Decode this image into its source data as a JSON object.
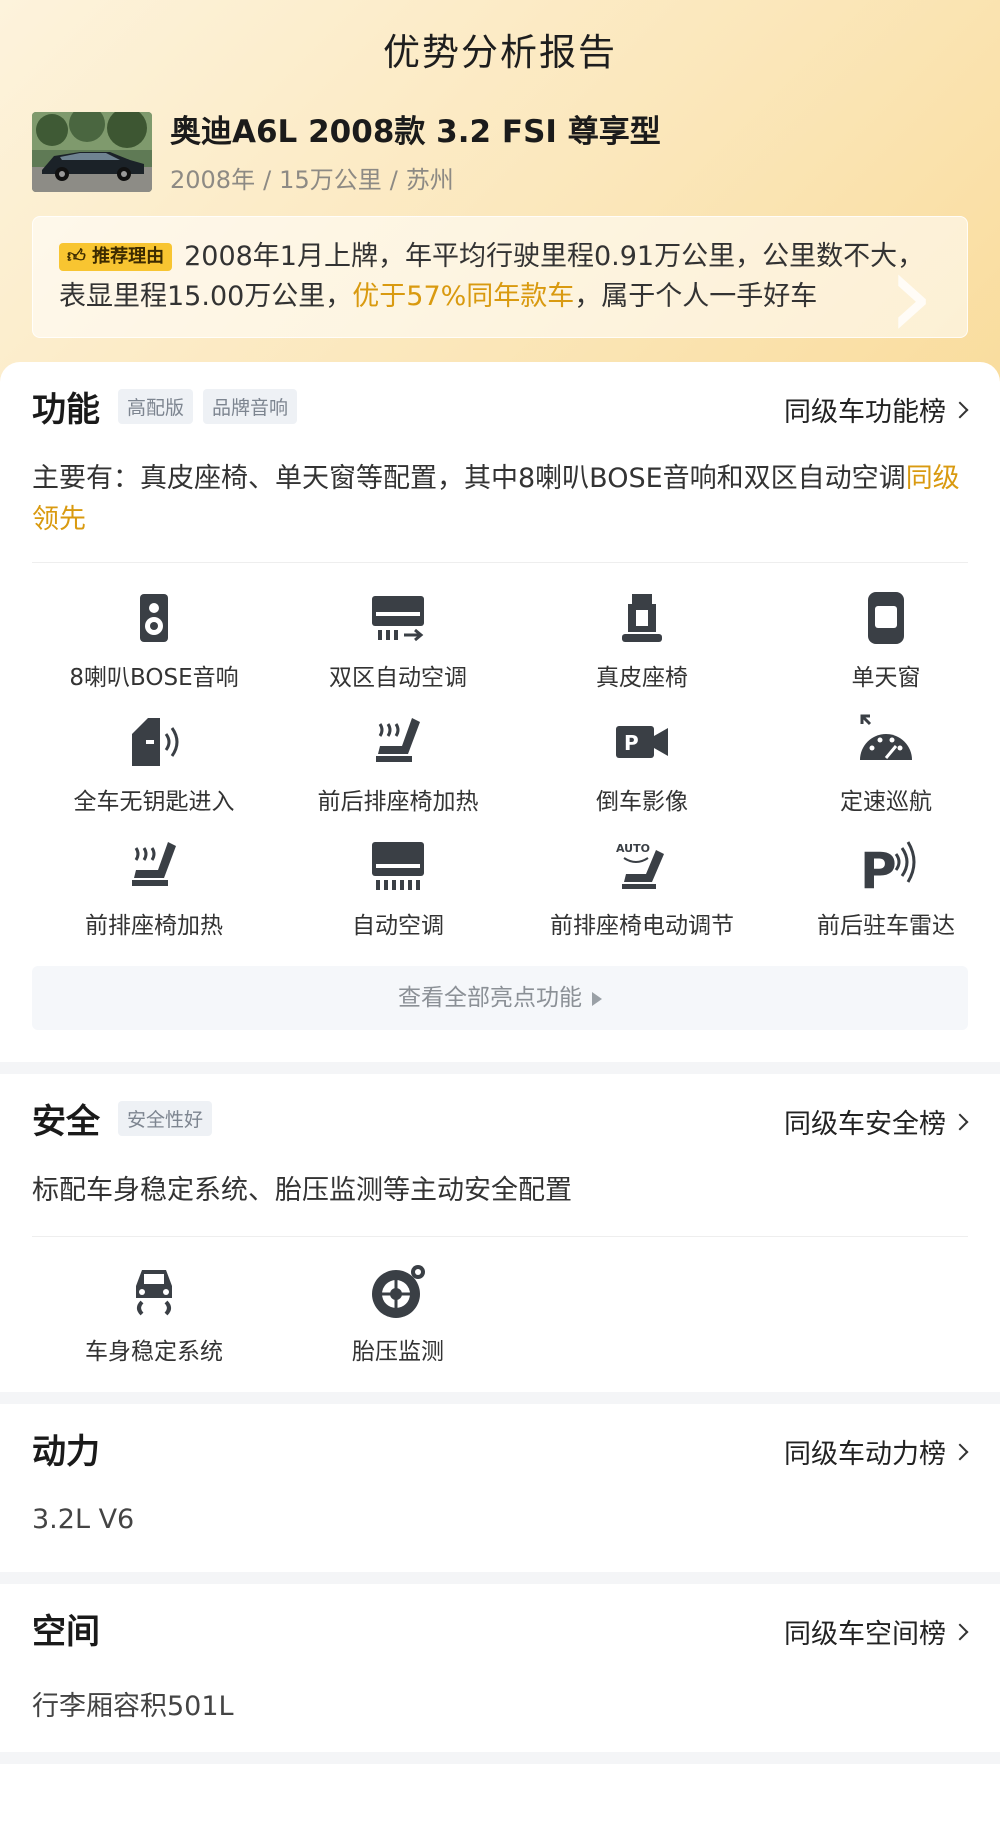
{
  "header": {
    "title": "优势分析报告"
  },
  "car": {
    "name": "奥迪A6L 2008款 3.2 FSI 尊享型",
    "year": "2008年",
    "mileage": "15万公里",
    "city": "苏州"
  },
  "reason": {
    "badge": "推荐理由",
    "text_a": "2008年1月上牌，年平均行驶里程0.91万公里，公里数不大，表显里程15.00万公里，",
    "highlight": "优于57%同年款车",
    "text_b": "，属于个人一手好车"
  },
  "function": {
    "title": "功能",
    "tags": [
      "高配版",
      "品牌音响"
    ],
    "link": "同级车功能榜",
    "desc_a": "主要有：真皮座椅、单天窗等配置，其中8喇叭BOSE音响和双区自动空调",
    "desc_highlight": "同级领先",
    "features": [
      {
        "label": "8喇叭BOSE音响",
        "icon": "speaker-icon"
      },
      {
        "label": "双区自动空调",
        "icon": "dual-zone-ac-icon"
      },
      {
        "label": "真皮座椅",
        "icon": "leather-seat-icon"
      },
      {
        "label": "单天窗",
        "icon": "sunroof-icon"
      },
      {
        "label": "全车无钥匙进入",
        "icon": "keyless-entry-icon"
      },
      {
        "label": "前后排座椅加热",
        "icon": "seat-heating-icon"
      },
      {
        "label": "倒车影像",
        "icon": "reverse-camera-icon"
      },
      {
        "label": "定速巡航",
        "icon": "cruise-control-icon"
      },
      {
        "label": "前排座椅加热",
        "icon": "front-seat-heating-icon"
      },
      {
        "label": "自动空调",
        "icon": "auto-ac-icon"
      },
      {
        "label": "前排座椅电动调节",
        "icon": "power-seat-icon"
      },
      {
        "label": "前后驻车雷达",
        "icon": "parking-radar-icon"
      }
    ],
    "see_all": "查看全部亮点功能"
  },
  "safety": {
    "title": "安全",
    "tags": [
      "安全性好"
    ],
    "link": "同级车安全榜",
    "desc": "标配车身稳定系统、胎压监测等主动安全配置",
    "features": [
      {
        "label": "车身稳定系统",
        "icon": "stability-control-icon"
      },
      {
        "label": "胎压监测",
        "icon": "tire-pressure-icon"
      }
    ]
  },
  "power": {
    "title": "动力",
    "link": "同级车动力榜",
    "value": "3.2L V6"
  },
  "space": {
    "title": "空间",
    "link": "同级车空间榜",
    "value": "行李厢容积501L"
  },
  "colors": {
    "accent": "#d99a10",
    "badge": "#f8c531",
    "hero_start": "#fdf3dc",
    "hero_end": "#f9dc9c"
  }
}
